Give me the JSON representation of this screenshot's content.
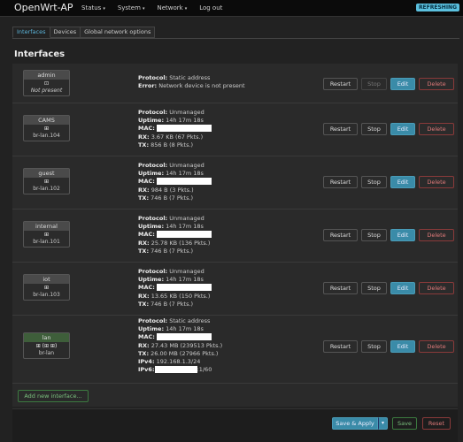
{
  "app": {
    "brand": "OpenWrt-AP",
    "indicator": "REFRESHING"
  },
  "nav": [
    {
      "label": "Status",
      "caret": "▾"
    },
    {
      "label": "System",
      "caret": "▾"
    },
    {
      "label": "Network",
      "caret": "▾"
    },
    {
      "label": "Log out",
      "caret": ""
    }
  ],
  "tabs": [
    "Interfaces",
    "Devices",
    "Global network options"
  ],
  "title": "Interfaces",
  "labels": {
    "protocol": "Protocol:",
    "uptime": "Uptime:",
    "mac": "MAC:",
    "rx": "RX:",
    "tx": "TX:",
    "error": "Error:",
    "ipv4": "IPv4:",
    "ipv6": "IPv6:"
  },
  "buttons": {
    "restart": "Restart",
    "stop": "Stop",
    "edit": "Edit",
    "delete": "Delete"
  },
  "interfaces": [
    {
      "name": "admin",
      "icon": "⊡",
      "device": "Not present",
      "protocol": "Static address",
      "error": "Network device is not present"
    },
    {
      "name": "CAMS",
      "icon": "⊞",
      "device": "br-lan.104",
      "protocol": "Unmanaged",
      "uptime": "14h 17m 18s",
      "rx": "3.67 KB (67 Pkts.)",
      "tx": "856 B (8 Pkts.)"
    },
    {
      "name": "guest",
      "icon": "⊞",
      "device": "br-lan.102",
      "protocol": "Unmanaged",
      "uptime": "14h 17m 18s",
      "rx": "984 B (3 Pkts.)",
      "tx": "746 B (7 Pkts.)"
    },
    {
      "name": "internal",
      "icon": "⊞",
      "device": "br-lan.101",
      "protocol": "Unmanaged",
      "uptime": "14h 17m 18s",
      "rx": "25.78 KB (136 Pkts.)",
      "tx": "746 B (7 Pkts.)"
    },
    {
      "name": "iot",
      "icon": "⊞",
      "device": "br-lan.103",
      "protocol": "Unmanaged",
      "uptime": "14h 17m 18s",
      "rx": "13.65 KB (150 Pkts.)",
      "tx": "746 B (7 Pkts.)"
    },
    {
      "name": "lan",
      "icon": "⊞ (⊞ ⊞)",
      "device": "br-lan",
      "protocol": "Static address",
      "uptime": "14h 17m 18s",
      "rx": "27.43 MB (239513 Pkts.)",
      "tx": "26.00 MB (27966 Pkts.)",
      "ipv4": "192.168.1.3/24",
      "ipv6_suffix": ":1/60"
    }
  ],
  "add_interface": "Add new interface...",
  "footer": {
    "save_apply": "Save & Apply",
    "save_apply_caret": "▾",
    "save": "Save",
    "reset": "Reset"
  }
}
